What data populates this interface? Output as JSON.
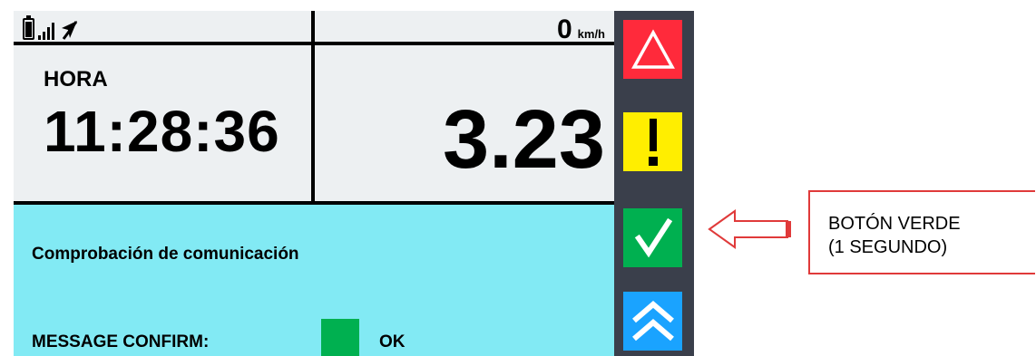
{
  "status": {
    "battery_icon": "battery-icon",
    "signal_icon": "signal-icon",
    "gps_icon": "navigation-arrow-icon",
    "speed_value": "0",
    "speed_unit": "km/h"
  },
  "clock": {
    "label": "HORA",
    "value": "11:28:36"
  },
  "distance": {
    "value": "3.23"
  },
  "message": {
    "title": "Comprobación de comunicación",
    "confirm_label": "MESSAGE CONFIRM:",
    "confirm_status": "OK",
    "confirm_color": "#00b050"
  },
  "sidebar": {
    "buttons": [
      {
        "icon": "alarm-triangle-icon",
        "color": "#ff2a3b"
      },
      {
        "icon": "exclamation-icon",
        "color": "#ffee00"
      },
      {
        "icon": "checkmark-icon",
        "color": "#00b050"
      },
      {
        "icon": "double-chevron-up-icon",
        "color": "#1aa3ff"
      }
    ]
  },
  "annotation": {
    "line1": "BOTÓN VERDE",
    "line2": "(1 SEGUNDO)",
    "color": "#e03a3a"
  }
}
